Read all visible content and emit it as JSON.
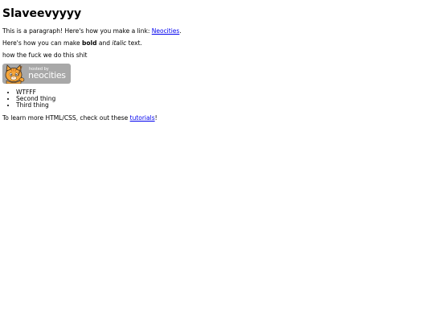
{
  "page": {
    "title": "Slaveevyyyy",
    "paragraph1_prefix": "This is a paragraph! Here's how you make a link: ",
    "paragraph1_link": "Neocities",
    "paragraph1_suffix": ".",
    "paragraph2_prefix": "Here's how you can make ",
    "paragraph2_bold": "bold",
    "paragraph2_mid": " and ",
    "paragraph2_italic": "italic",
    "paragraph2_suffix": " text.",
    "paragraph3": "how the fuck we do this shit",
    "badge": {
      "hosted_by": "hosted by",
      "name": "neocities",
      "icon": "neocities-cat-icon"
    },
    "list": [
      "WTFFF",
      "Second thing",
      "Third thing"
    ],
    "footer_prefix": "To learn more HTML/CSS, check out these ",
    "footer_link": "tutorials",
    "footer_suffix": "!"
  },
  "colors": {
    "link": "#0000ee",
    "badge_bg": "#a8a8a8",
    "cat_orange": "#f4a53a"
  }
}
